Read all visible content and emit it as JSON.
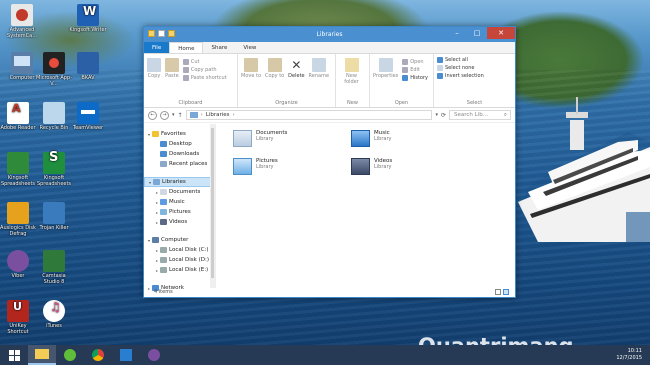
{
  "desktop_icons": [
    {
      "label": "Advanced SystemCa...",
      "color": "#e8e8e8",
      "accent": "#c0392b"
    },
    {
      "label": "Kingsoft Writer",
      "color": "#1f5fb4",
      "accent": "#ffffff"
    },
    {
      "label": "Computer",
      "color": "#5a7ea8",
      "accent": "#cfe3f6"
    },
    {
      "label": "Microsoft App-V...",
      "color": "#222222",
      "accent": "#e74c3c"
    },
    {
      "label": "BKAV",
      "color": "#2b5fa6",
      "accent": "#ffffff"
    },
    {
      "label": "Adobe Reader",
      "color": "#ffffff",
      "accent": "#c0392b"
    },
    {
      "label": "Recycle Bin",
      "color": "#bcd6ec",
      "accent": "#ffffff"
    },
    {
      "label": "TeamViewer",
      "color": "#0e6ac7",
      "accent": "#ffffff"
    },
    {
      "label": "Kingsoft Spreadsheets",
      "color": "#2f8b3a",
      "accent": "#ffffff"
    },
    {
      "label": "Kingsoft Spreadsheets",
      "color": "#1f8f3e",
      "accent": "#ffffff"
    },
    {
      "label": "Auslogics Disk Defrag",
      "color": "#e6a21c",
      "accent": "#2b7bd0"
    },
    {
      "label": "Trojan Killer",
      "color": "#3a7bbd",
      "accent": "#ffffff"
    },
    {
      "label": "Viber",
      "color": "#7b4fa0",
      "accent": "#ffffff"
    },
    {
      "label": "Camtasia Studio 8",
      "color": "#2f7a3a",
      "accent": "#ffffff"
    },
    {
      "label": "UniKey Shortcut",
      "color": "#b3261e",
      "accent": "#ffffff"
    },
    {
      "label": "iTunes",
      "color": "#ffffff",
      "accent": "#e84a8a"
    }
  ],
  "window": {
    "title": "Libraries",
    "tabs": [
      "File",
      "Home",
      "Share",
      "View"
    ],
    "ribbon": {
      "clipboard": {
        "copy": "Copy",
        "paste": "Paste",
        "cut": "Cut",
        "copy_path": "Copy path",
        "paste_shortcut": "Paste shortcut",
        "group": "Clipboard"
      },
      "organize": {
        "move_to": "Move to",
        "copy_to": "Copy to",
        "delete": "Delete",
        "rename": "Rename",
        "group": "Organize"
      },
      "new": {
        "new_folder": "New folder",
        "group": "New"
      },
      "open": {
        "properties": "Properties",
        "open": "Open",
        "edit": "Edit",
        "history": "History",
        "group": "Open"
      },
      "select": {
        "select_all": "Select all",
        "select_none": "Select none",
        "invert": "Invert selection",
        "group": "Select"
      }
    },
    "address": {
      "crumb": "Libraries",
      "search_placeholder": "Search Lib..."
    },
    "nav": {
      "favorites": "Favorites",
      "desktop": "Desktop",
      "downloads": "Downloads",
      "recent": "Recent places",
      "libraries": "Libraries",
      "documents": "Documents",
      "music": "Music",
      "pictures": "Pictures",
      "videos": "Videos",
      "computer": "Computer",
      "disk_c": "Local Disk (C:)",
      "disk_d": "Local Disk (D:)",
      "disk_e": "Local Disk (E:)",
      "network": "Network"
    },
    "libraries": [
      {
        "name": "Documents",
        "type": "Library"
      },
      {
        "name": "Music",
        "type": "Library"
      },
      {
        "name": "Pictures",
        "type": "Library"
      },
      {
        "name": "Videos",
        "type": "Library"
      }
    ],
    "status": "4 items"
  },
  "taskbar": {
    "date": "12/7/2015",
    "time": "10:11"
  },
  "watermark": "Quantrimang"
}
